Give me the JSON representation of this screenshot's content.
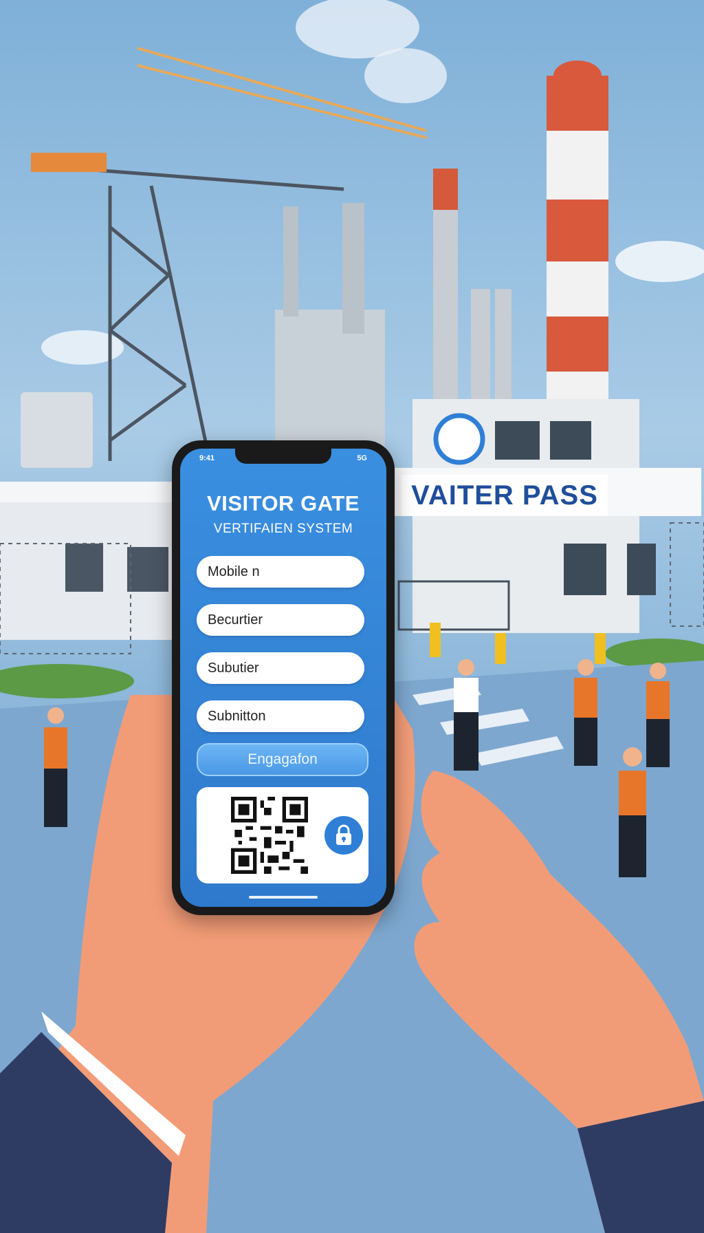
{
  "phone": {
    "status_left": "9:41",
    "status_right": "5G",
    "title": "VISITOR GATE",
    "subtitle": "VERTIFAIEN SYSTEM",
    "fields": [
      {
        "value": "Mobile n"
      },
      {
        "value": "Becurtier"
      },
      {
        "value": "Subutier"
      },
      {
        "value": "Subnitton"
      }
    ],
    "button_label": "Engagafon",
    "icons": {
      "qr": "qr-code-icon",
      "lock": "lock-icon"
    }
  },
  "gate": {
    "sign_text": "VAITER PASS",
    "logo_icon": "gate-logo-icon"
  },
  "colors": {
    "accent": "#2f7fd6",
    "button": "#5aa6ee",
    "sign_text": "#1f4e9b"
  }
}
